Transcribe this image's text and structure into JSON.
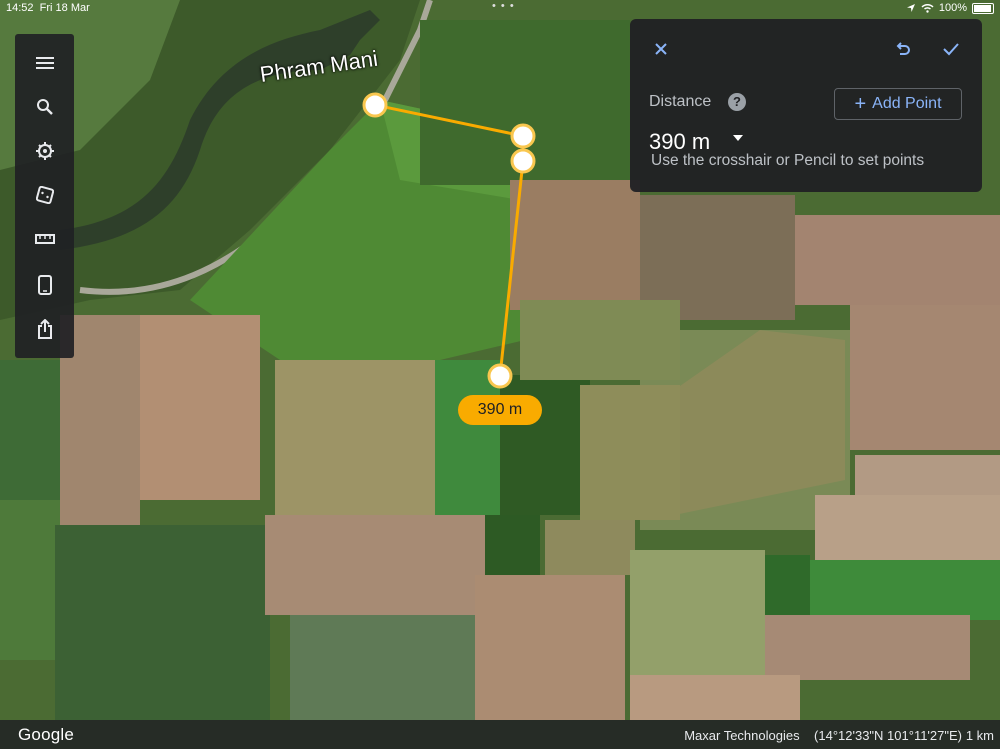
{
  "status": {
    "time": "14:52",
    "date": "Fri 18 Mar",
    "battery": "100%",
    "multitask_dots": "• • •"
  },
  "toolbar": {
    "items": [
      {
        "name": "menu-icon"
      },
      {
        "name": "search-icon"
      },
      {
        "name": "voyager-icon"
      },
      {
        "name": "feeling-lucky-icon"
      },
      {
        "name": "ruler-icon"
      },
      {
        "name": "phone-icon"
      },
      {
        "name": "share-icon"
      }
    ]
  },
  "measure": {
    "distance_label": "Distance",
    "help_label": "?",
    "distance_value": "390 m",
    "add_point_label": "Add Point",
    "hint": "Use the crosshair or Pencil to set points",
    "pill_label": "390 m"
  },
  "map": {
    "place_label": "Phram Mani",
    "line_color": "#f9ab00",
    "point_border_color": "#f9c74f"
  },
  "footer": {
    "brand": "Google",
    "credits": "Maxar Technologies",
    "coords": "(14°12'33\"N 101°11'27\"E)",
    "scale": "1 km"
  }
}
